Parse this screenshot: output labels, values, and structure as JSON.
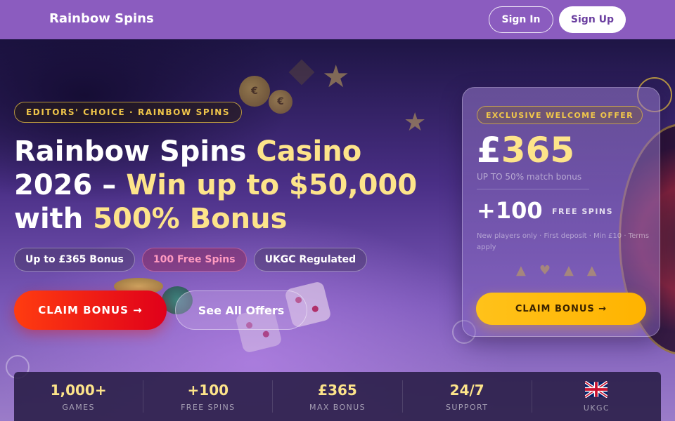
{
  "nav": {
    "brand": "Rainbow Spins",
    "sign_in": "Sign In",
    "sign_up": "Sign Up"
  },
  "hero": {
    "badge": "EDITORS' CHOICE · RAINBOW SPINS",
    "headline": {
      "part1": "Rainbow Spins ",
      "part2": "Casino",
      "part3": "2026 – ",
      "part4": "Win up to $50,000",
      "part5": "with ",
      "part6": "500% Bonus"
    },
    "chips": [
      "Up to £365 Bonus",
      "100 Free Spins",
      "UKGC Regulated"
    ],
    "claim_button": "CLAIM BONUS →",
    "offers_button": "See All Offers"
  },
  "offer_card": {
    "tag": "EXCLUSIVE WELCOME OFFER",
    "amount_symbol": "£",
    "amount_value": "365",
    "match_text": "UP TO 50% match bonus",
    "spins": "+100",
    "spins_label": "FREE SPINS",
    "terms": "New players only · First deposit · Min £10 · Terms apply",
    "suits": [
      "▲",
      "♥",
      "▲",
      "▲"
    ],
    "claim_button": "CLAIM BONUS →"
  },
  "stats": [
    {
      "value": "1,000+",
      "label": "GAMES"
    },
    {
      "value": "+100",
      "label": "FREE SPINS"
    },
    {
      "value": "£365",
      "label": "MAX BONUS"
    },
    {
      "value": "24/7",
      "label": "SUPPORT"
    },
    {
      "value": "",
      "label": "UKGC",
      "icon": "uk-flag-icon"
    }
  ],
  "colors": {
    "nav_bg": "#8b5cbf",
    "gold": "#fde48a",
    "claim_red": "#e0001a",
    "claim_gold": "#ffc21a",
    "stats_bg": "#281c46"
  },
  "decor": {
    "coin_symbol_1": "€",
    "coin_symbol_2": "€"
  }
}
